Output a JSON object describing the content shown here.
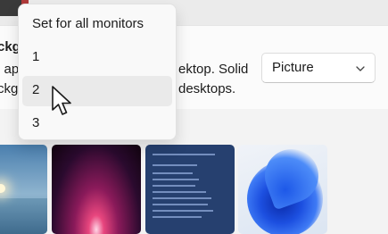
{
  "card": {
    "title_fragment": "ckg",
    "line2_left": "l ap",
    "line2_right": "ektop. Solid",
    "line3_left": "ckg",
    "line3_right": "desktops."
  },
  "background_type_select": {
    "value": "Picture"
  },
  "monitor_menu": {
    "items": [
      {
        "label": "Set for all monitors"
      },
      {
        "label": "1"
      },
      {
        "label": "2",
        "hovered": true
      },
      {
        "label": "3"
      }
    ]
  },
  "wallpapers": [
    {
      "name": "sunrise-sea"
    },
    {
      "name": "magenta-glow"
    },
    {
      "name": "blue-text-screen"
    },
    {
      "name": "blue-bloom"
    }
  ],
  "colors": {
    "menu_hover": "#eaeaea",
    "accent_blue": "#1c4fe0"
  },
  "icons": {
    "select": "chevron-down-icon",
    "pointer": "mouse-cursor-icon"
  }
}
